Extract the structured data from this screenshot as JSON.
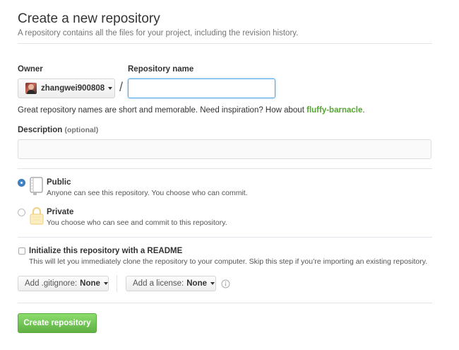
{
  "header": {
    "title": "Create a new repository",
    "subtitle": "A repository contains all the files for your project, including the revision history."
  },
  "owner": {
    "label": "Owner",
    "value": "zhangwei900808"
  },
  "repo_name": {
    "label": "Repository name",
    "value": "",
    "placeholder": ""
  },
  "slash": "/",
  "suggestion": {
    "text": "Great repository names are short and memorable. Need inspiration? How about ",
    "name": "fluffy-barnacle",
    "end": "."
  },
  "description": {
    "label": "Description",
    "optional": "(optional)",
    "value": "",
    "placeholder": ""
  },
  "visibility": {
    "public": {
      "label": "Public",
      "desc": "Anyone can see this repository. You choose who can commit.",
      "selected": true
    },
    "private": {
      "label": "Private",
      "desc": "You choose who can see and commit to this repository.",
      "selected": false
    }
  },
  "readme": {
    "label": "Initialize this repository with a README",
    "desc": "This will let you immediately clone the repository to your computer. Skip this step if you’re importing an existing repository.",
    "checked": false
  },
  "gitignore": {
    "label": "Add .gitignore:",
    "value": "None"
  },
  "license": {
    "label": "Add a license:",
    "value": "None"
  },
  "create_button": "Create repository",
  "colors": {
    "accent_blue": "#4183c4",
    "create_green": "#60b044",
    "suggestion_green": "#55a532"
  },
  "icons": [
    "info-icon",
    "book-icon",
    "lock-icon",
    "avatar"
  ]
}
